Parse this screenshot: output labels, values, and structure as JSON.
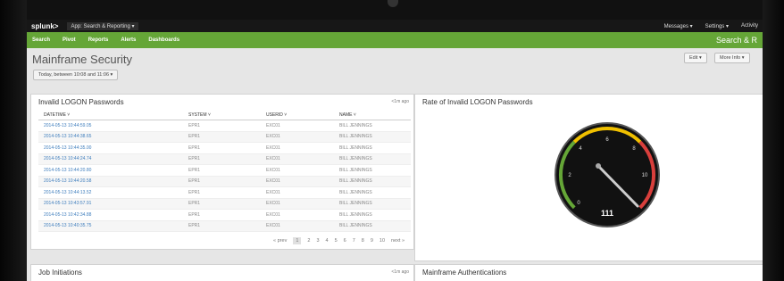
{
  "topbar": {
    "logo": "splunk>",
    "app_menu": "App: Search & Reporting ▾",
    "messages": "Messages ▾",
    "settings": "Settings ▾",
    "activity": "Activity"
  },
  "nav": {
    "links": [
      "Search",
      "Pivot",
      "Reports",
      "Alerts",
      "Dashboards"
    ],
    "right_label": "Search & R"
  },
  "header": {
    "title": "Mainframe Security",
    "time_picker": "Today, between 10:08 and 11:06 ▾",
    "edit_label": "Edit ▾",
    "more_info_label": "More Info ▾"
  },
  "panels": {
    "logon_table": {
      "title": "Invalid LOGON Passwords",
      "time_ago": "<1m ago",
      "columns": [
        "DATETIME ˅",
        "SYSTEM ˅",
        "USERID ˅",
        "NAME ˅"
      ],
      "rows": [
        [
          "2014-05-13 10:44:59.05",
          "EPR1",
          "EXC01",
          "BILL JENNINGS"
        ],
        [
          "2014-05-13 10:44:38.65",
          "EPR1",
          "EXC01",
          "BILL JENNINGS"
        ],
        [
          "2014-05-13 10:44:35.00",
          "EPR1",
          "EXC01",
          "BILL JENNINGS"
        ],
        [
          "2014-05-13 10:44:24.74",
          "EPR1",
          "EXC01",
          "BILL JENNINGS"
        ],
        [
          "2014-05-13 10:44:20.80",
          "EPR1",
          "EXC01",
          "BILL JENNINGS"
        ],
        [
          "2014-05-13 10:44:20.58",
          "EPR1",
          "EXC01",
          "BILL JENNINGS"
        ],
        [
          "2014-05-13 10:44:13.52",
          "EPR1",
          "EXC01",
          "BILL JENNINGS"
        ],
        [
          "2014-05-13 10:43:57.91",
          "EPR1",
          "EXC01",
          "BILL JENNINGS"
        ],
        [
          "2014-05-13 10:42:34.88",
          "EPR1",
          "EXC01",
          "BILL JENNINGS"
        ],
        [
          "2014-05-13 10:40:35.75",
          "EPR1",
          "EXC01",
          "BILL JENNINGS"
        ]
      ],
      "pagination": {
        "prev": "« prev",
        "pages": [
          "1",
          "2",
          "3",
          "4",
          "5",
          "6",
          "7",
          "8",
          "9",
          "10"
        ],
        "next": "next »",
        "current": "1"
      }
    },
    "gauge": {
      "title": "Rate of Invalid LOGON Passwords",
      "value_text": "111",
      "ticks": [
        "0",
        "2",
        "4",
        "6",
        "8",
        "10"
      ],
      "colors": {
        "green": "#65a637",
        "yellow": "#f0c000",
        "red": "#d93f3c"
      }
    },
    "job_initiations": {
      "title": "Job Initiations",
      "time_ago": "<1m ago"
    },
    "mainframe_auth": {
      "title": "Mainframe Authentications"
    }
  }
}
